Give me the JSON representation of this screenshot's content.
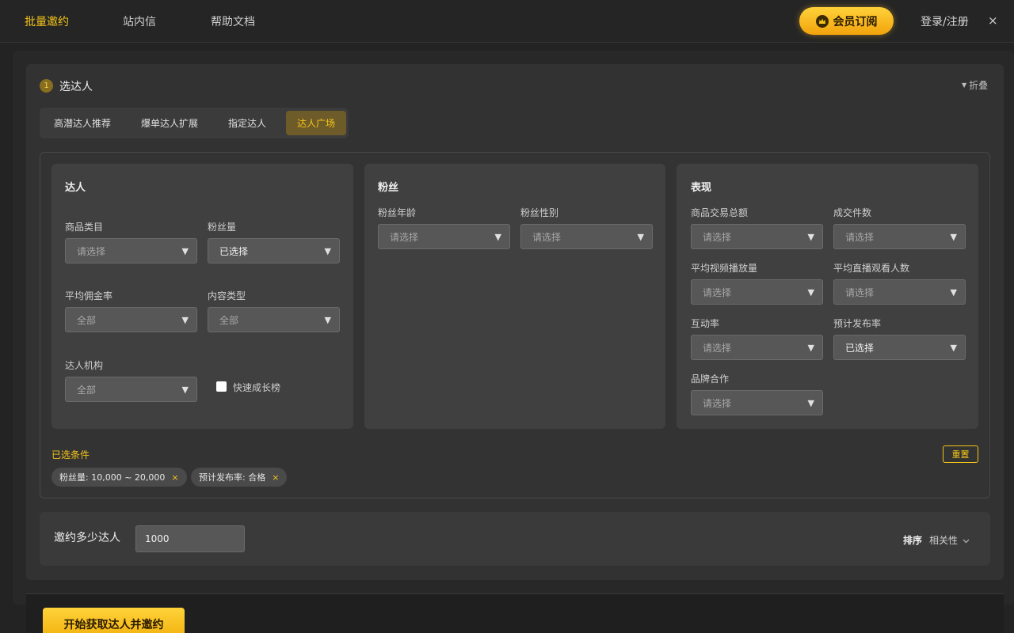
{
  "nav": {
    "items": [
      "批量邀约",
      "站内信",
      "帮助文档"
    ],
    "vip_label": "会员订阅",
    "login_label": "登录/注册",
    "close_label": "×"
  },
  "step": {
    "number": "1",
    "title": "选达人",
    "collapse_label": "折叠"
  },
  "tabs": [
    "高潜达人推荐",
    "爆单达人扩展",
    "指定达人",
    "达人广场"
  ],
  "panels": {
    "creator": {
      "title": "达人",
      "category_label": "商品类目",
      "category_value": "请选择",
      "fans_label": "粉丝量",
      "fans_value": "已选择",
      "commission_label": "平均佣金率",
      "commission_value": "全部",
      "content_label": "内容类型",
      "content_value": "全部",
      "agency_label": "达人机构",
      "agency_value": "全部",
      "fast_growth_label": "快速成长榜"
    },
    "fans": {
      "title": "粉丝",
      "age_label": "粉丝年龄",
      "age_value": "请选择",
      "gender_label": "粉丝性别",
      "gender_value": "请选择"
    },
    "performance": {
      "title": "表现",
      "gmv_label": "商品交易总额",
      "gmv_value": "请选择",
      "orders_label": "成交件数",
      "orders_value": "请选择",
      "video_label": "平均视频播放量",
      "video_value": "请选择",
      "live_label": "平均直播观看人数",
      "live_value": "请选择",
      "engage_label": "互动率",
      "engage_value": "请选择",
      "publish_label": "预计发布率",
      "publish_value": "已选择",
      "brand_label": "品牌合作",
      "brand_value": "请选择"
    }
  },
  "selected": {
    "label": "已选条件",
    "reset_label": "重置",
    "chips": [
      "粉丝量: 10,000 ~ 20,000",
      "预计发布率: 合格"
    ]
  },
  "invite": {
    "label": "邀约多少达人",
    "value": "1000",
    "sort_label": "排序",
    "sort_value": "相关性"
  },
  "start_label": "开始获取达人并邀约",
  "colors": {
    "accent": "#f5c518",
    "background": "#232323"
  }
}
